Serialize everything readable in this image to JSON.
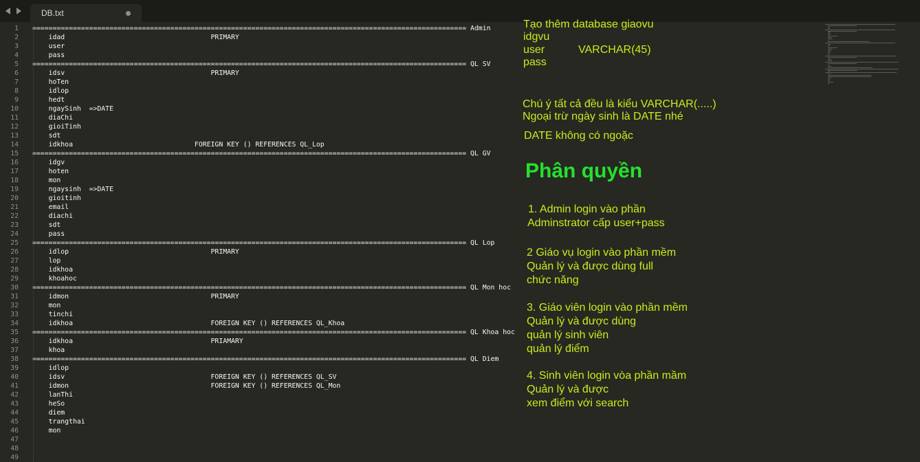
{
  "tab": {
    "title": "DB.txt"
  },
  "lines": [
    "=========================================================================================================== Admin",
    "    idad                                    PRIMARY",
    "    user",
    "    pass",
    "=========================================================================================================== QL SV",
    "    idsv                                    PRIMARY",
    "    hoTen",
    "    idlop",
    "    hedt",
    "    ngaySinh  =>DATE",
    "    diaChi",
    "    gioiTinh",
    "    sdt",
    "    idkhoa                              FOREIGN KEY () REFERENCES QL_Lop",
    "=========================================================================================================== QL GV",
    "    idgv",
    "    hoten",
    "    mon",
    "    ngaysinh  =>DATE",
    "    gioitinh",
    "    email",
    "    diachi",
    "    sdt",
    "    pass",
    "=========================================================================================================== QL Lop",
    "    idlop                                   PRIMARY",
    "    lop",
    "    idkhoa",
    "    khoahoc",
    "=========================================================================================================== QL Mon hoc",
    "    idmon                                   PRIMARY",
    "    mon",
    "    tinchi",
    "    idkhoa                                  FOREIGN KEY () REFERENCES QL_Khoa",
    "=========================================================================================================== QL Khoa hoc",
    "    idkhoa                                  PRIAMARY",
    "    khoa",
    "=========================================================================================================== QL Diem",
    "    idlop",
    "    idsv                                    FOREIGN KEY () REFERENCES QL_SV",
    "    idmon                                   FOREIGN KEY () REFERENCES QL_Mon",
    "    lanThi",
    "    heSo",
    "    diem",
    "    trangthai",
    "    mon",
    "",
    "",
    ""
  ],
  "notes": {
    "n1": "Tạo thêm database giaovu",
    "n2": "idgvu",
    "n3": "user           VARCHAR(45)",
    "n4": "pass",
    "n5": "Chú ý tất cả đều là kiểu VARCHAR(.....)",
    "n6": "Ngoại trừ ngày sinh là DATE nhé",
    "n7": "DATE không có ngoặc",
    "heading": "Phân quyền",
    "p1a": "1. Admin login vào phần",
    "p1b": "Adminstrator cấp user+pass",
    "p2a": "2 Giáo vụ login vào phần mềm",
    "p2b": "Quản lý và được dùng full",
    "p2c": "chức năng",
    "p3a": "3. Giáo viên login vào phần mềm",
    "p3b": "Quản lý và được dùng",
    "p3c": "quản lý sinh viên",
    "p3d": "quản lý điểm",
    "p4a": "4. Sinh viên login vòa phần mầm",
    "p4b": "Quản lý và được",
    "p4c": "xem điểm với search"
  },
  "colors": {
    "background": "#272822",
    "note_text": "#c8ec1c",
    "heading": "#25e12f"
  }
}
